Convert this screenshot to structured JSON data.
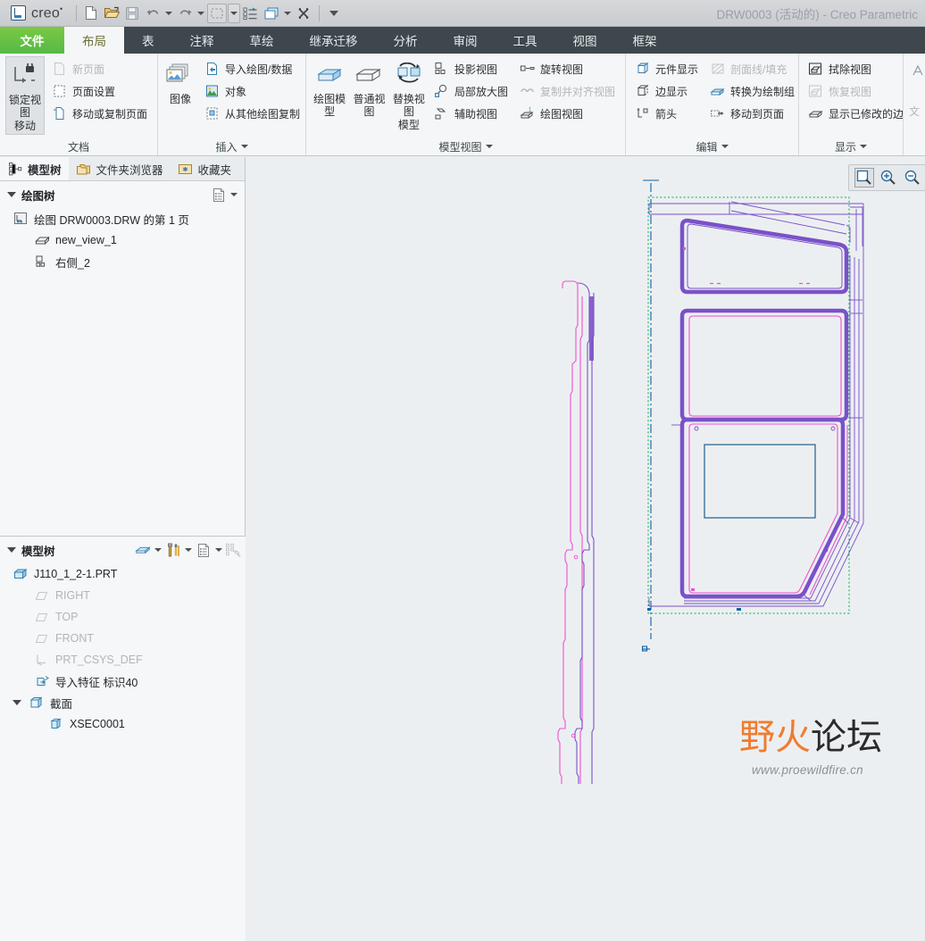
{
  "window": {
    "brand": "creo",
    "brand_sup": "•",
    "title": "DRW0003 (活动的) - Creo Parametric"
  },
  "quick_access": [
    {
      "name": "new-file-icon",
      "label": "新建"
    },
    {
      "name": "open-file-icon",
      "label": "打开"
    },
    {
      "name": "save-icon",
      "label": "保存"
    },
    {
      "name": "undo-icon",
      "label": "撤消"
    },
    {
      "name": "undo-dropdown-icon",
      "label": "撤消下拉"
    },
    {
      "name": "redo-icon",
      "label": "重做"
    },
    {
      "name": "redo-dropdown-icon",
      "label": "重做下拉"
    },
    {
      "name": "select-box-icon",
      "label": "选择"
    },
    {
      "name": "select-dropdown-icon",
      "label": "选择下拉"
    },
    {
      "name": "regenerate-icon",
      "label": "重新生成"
    },
    {
      "name": "window-icon",
      "label": "窗口"
    },
    {
      "name": "window-dropdown-icon",
      "label": "窗口下拉"
    },
    {
      "name": "close-window-icon",
      "label": "关闭"
    },
    {
      "name": "customize-qat-icon",
      "label": "自定义快速访问工具栏"
    }
  ],
  "ribbon": {
    "tabs": [
      {
        "label": "文件",
        "state": "file"
      },
      {
        "label": "布局",
        "state": "active"
      },
      {
        "label": "表",
        "state": "normal"
      },
      {
        "label": "注释",
        "state": "normal"
      },
      {
        "label": "草绘",
        "state": "normal"
      },
      {
        "label": "继承迁移",
        "state": "normal"
      },
      {
        "label": "分析",
        "state": "normal"
      },
      {
        "label": "审阅",
        "state": "normal"
      },
      {
        "label": "工具",
        "state": "normal"
      },
      {
        "label": "视图",
        "state": "normal"
      },
      {
        "label": "框架",
        "state": "normal"
      }
    ],
    "groups": [
      {
        "title": "文档",
        "has_dropdown": false,
        "big": [
          {
            "label_line1": "锁定视图",
            "label_line2": "移动",
            "icon": "lock-view-movement-icon",
            "selected": true,
            "disabled": false
          }
        ],
        "small": [
          {
            "label": "新页面",
            "icon": "new-sheet-icon",
            "disabled": true
          },
          {
            "label": "页面设置",
            "icon": "sheet-setup-icon",
            "disabled": false
          },
          {
            "label": "移动或复制页面",
            "icon": "move-copy-sheet-icon",
            "disabled": false
          }
        ]
      },
      {
        "title": "插入",
        "has_dropdown": true,
        "big": [
          {
            "label_line1": "图像",
            "label_line2": "",
            "icon": "image-icon",
            "selected": false,
            "disabled": false
          }
        ],
        "small": [
          {
            "label": "导入绘图/数据",
            "icon": "import-drawing-data-icon",
            "disabled": false
          },
          {
            "label": "对象",
            "icon": "object-icon",
            "disabled": false
          },
          {
            "label": "从其他绘图复制",
            "icon": "copy-from-other-drawing-icon",
            "disabled": false
          }
        ]
      },
      {
        "title": "模型视图",
        "has_dropdown": true,
        "big": [
          {
            "label_line1": "绘图模型",
            "label_line2": "",
            "icon": "drawing-model-icon",
            "selected": false,
            "disabled": false
          },
          {
            "label_line1": "普通视图",
            "label_line2": "",
            "icon": "general-view-icon",
            "selected": false,
            "disabled": false
          },
          {
            "label_line1": "替换视图",
            "label_line2": "模型",
            "icon": "replace-view-model-icon",
            "selected": false,
            "disabled": false
          }
        ],
        "small": [
          {
            "label": "投影视图",
            "icon": "projection-view-icon",
            "disabled": false
          },
          {
            "label": "局部放大图",
            "icon": "detailed-view-icon",
            "disabled": false
          },
          {
            "label": "辅助视图",
            "icon": "auxiliary-view-icon",
            "disabled": false
          }
        ],
        "small2": [
          {
            "label": "旋转视图",
            "icon": "revolved-view-icon",
            "disabled": false
          },
          {
            "label": "复制并对齐视图",
            "icon": "copy-align-view-icon",
            "disabled": true
          },
          {
            "label": "绘图视图",
            "icon": "drawing-view-icon",
            "disabled": false
          }
        ]
      },
      {
        "title": "编辑",
        "has_dropdown": true,
        "small": [
          {
            "label": "元件显示",
            "icon": "component-display-icon",
            "disabled": false
          },
          {
            "label": "边显示",
            "icon": "edge-display-icon",
            "disabled": false
          },
          {
            "label": "箭头",
            "icon": "arrows-icon",
            "disabled": false
          }
        ],
        "small2": [
          {
            "label": "剖面线/填充",
            "icon": "hatch-fill-icon",
            "disabled": true
          },
          {
            "label": "转换为绘制组",
            "icon": "convert-to-draft-group-icon",
            "disabled": false
          },
          {
            "label": "移动到页面",
            "icon": "move-to-sheet-icon",
            "disabled": false
          }
        ]
      },
      {
        "title": "显示",
        "has_dropdown": true,
        "small": [
          {
            "label": "拭除视图",
            "icon": "erase-view-icon",
            "disabled": false
          },
          {
            "label": "恢复视图",
            "icon": "resume-view-icon",
            "disabled": true
          },
          {
            "label": "显示已修改的边",
            "icon": "show-modified-edges-icon",
            "disabled": false
          }
        ]
      },
      {
        "title": "",
        "has_dropdown": false,
        "small": [
          {
            "label": "文",
            "icon": "text-style-icon",
            "disabled": true
          }
        ]
      }
    ]
  },
  "left_panel": {
    "nav_tabs": [
      {
        "label": "模型树",
        "icon": "model-tree-icon",
        "active": true
      },
      {
        "label": "文件夹浏览器",
        "icon": "folder-browser-icon",
        "active": false
      },
      {
        "label": "收藏夹",
        "icon": "favorites-icon",
        "active": false
      }
    ],
    "drawing_tree": {
      "title": "绘图树",
      "tools": [
        {
          "name": "tree-settings-icon",
          "label": "设置"
        },
        {
          "name": "tree-settings-dropdown-icon",
          "label": "设置下拉"
        }
      ],
      "items": [
        {
          "label": "绘图 DRW0003.DRW 的第 1 页",
          "icon": "drawing-sheet-icon",
          "indent": 0,
          "dim": false
        },
        {
          "label": "new_view_1",
          "icon": "view-icon",
          "indent": 1,
          "dim": false
        },
        {
          "label": "右侧_2",
          "icon": "projection-view-small-icon",
          "indent": 1,
          "dim": false
        }
      ]
    },
    "model_tree": {
      "title": "模型树",
      "tools": [
        {
          "name": "display-filter-icon",
          "label": "显示"
        },
        {
          "name": "display-filter-dropdown-icon",
          "label": "显示下拉"
        },
        {
          "name": "settings-tools-icon",
          "label": "设置"
        },
        {
          "name": "settings-tools-dropdown-icon",
          "label": "设置下拉"
        },
        {
          "name": "tree-columns-icon",
          "label": "树列"
        },
        {
          "name": "tree-columns-dropdown-icon",
          "label": "树列下拉"
        },
        {
          "name": "tree-filter-off-icon",
          "label": "树过滤器"
        }
      ],
      "items": [
        {
          "label": "J110_1_2-1.PRT",
          "icon": "part-icon",
          "indent": 0,
          "dim": false,
          "expander": "none"
        },
        {
          "label": "RIGHT",
          "icon": "datum-plane-icon",
          "indent": 1,
          "dim": true,
          "expander": "none"
        },
        {
          "label": "TOP",
          "icon": "datum-plane-icon",
          "indent": 1,
          "dim": true,
          "expander": "none"
        },
        {
          "label": "FRONT",
          "icon": "datum-plane-icon",
          "indent": 1,
          "dim": true,
          "expander": "none"
        },
        {
          "label": "PRT_CSYS_DEF",
          "icon": "coordinate-system-icon",
          "indent": 1,
          "dim": true,
          "expander": "none"
        },
        {
          "label": "导入特征 标识40",
          "icon": "import-feature-icon",
          "indent": 1,
          "dim": false,
          "expander": "none"
        },
        {
          "label": "截面",
          "icon": "sections-folder-icon",
          "indent": 0,
          "dim": false,
          "expander": "open"
        },
        {
          "label": "XSEC0001",
          "icon": "cross-section-icon",
          "indent": 2,
          "dim": false,
          "expander": "none"
        }
      ]
    }
  },
  "canvas": {
    "zoom_tools": [
      {
        "name": "zoom-to-fit-icon",
        "label": "重新调整",
        "selected": true
      },
      {
        "name": "zoom-in-icon",
        "label": "放大",
        "selected": false
      },
      {
        "name": "zoom-out-icon",
        "label": "缩小",
        "selected": false
      }
    ],
    "watermark": {
      "line1_a": "野",
      "line1_b": "火",
      "line1_c": "论坛",
      "line2": "www.proewildfire.cn"
    },
    "colors": {
      "background": "#eceff1",
      "geometry_primary": "#7a51c9",
      "geometry_secondary": "#f050d0",
      "view_outline": "#00b050",
      "centerline": "#1060a8",
      "selection_box": "#1f5f8f"
    }
  }
}
